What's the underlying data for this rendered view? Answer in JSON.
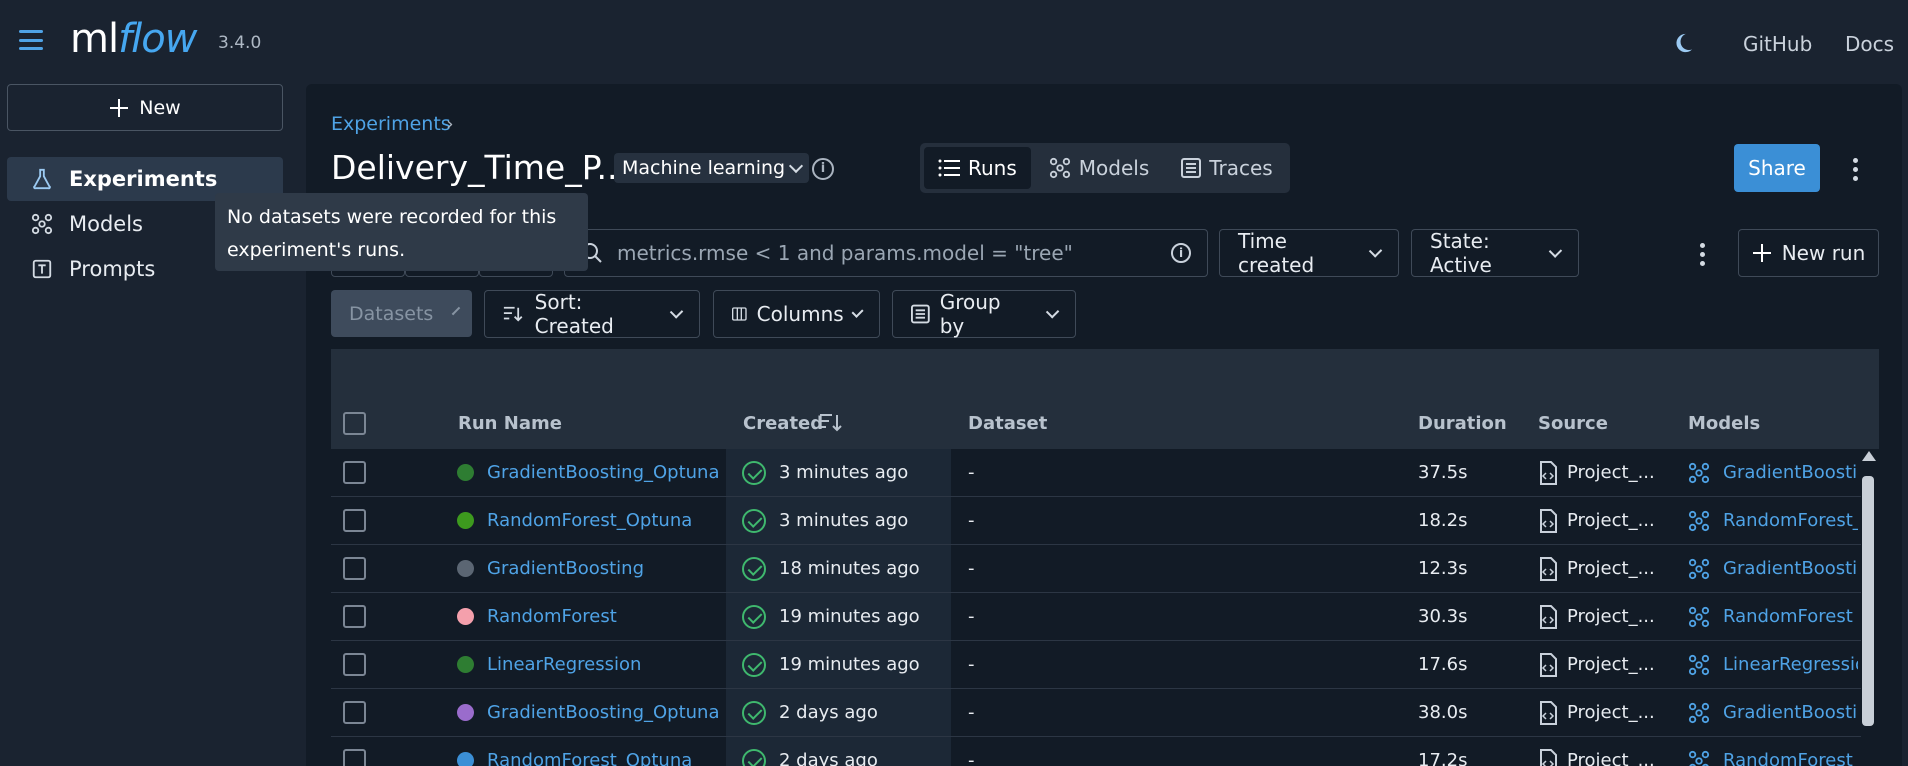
{
  "app": {
    "logo_ml": "ml",
    "logo_flow": "flow",
    "version": "3.4.0",
    "github_label": "GitHub",
    "docs_label": "Docs"
  },
  "sidebar": {
    "new_label": "New",
    "items": [
      {
        "label": "Experiments",
        "icon": "flask-icon"
      },
      {
        "label": "Models",
        "icon": "models-icon"
      },
      {
        "label": "Prompts",
        "icon": "prompt-icon"
      }
    ]
  },
  "header": {
    "breadcrumb": "Experiments",
    "title": "Delivery_Time_P...",
    "type_label": "Machine learning",
    "tabs": [
      {
        "label": "Runs"
      },
      {
        "label": "Models"
      },
      {
        "label": "Traces"
      }
    ],
    "share_label": "Share"
  },
  "tooltip": {
    "text_line1": "No datasets were recorded for this",
    "text_line2": "experiment's runs."
  },
  "toolbar": {
    "search_placeholder": "metrics.rmse < 1 and params.model = \"tree\"",
    "time_created": "Time created",
    "state": "State: Active",
    "new_run": "New run",
    "datasets": "Datasets",
    "sort": "Sort: Created",
    "columns": "Columns",
    "group_by": "Group by"
  },
  "table": {
    "headers": [
      "Run Name",
      "Created",
      "Dataset",
      "Duration",
      "Source",
      "Models"
    ],
    "rows": [
      {
        "name": "GradientBoosting_Optuna",
        "color": "#2e7d32",
        "created": "3 minutes ago",
        "dataset": "-",
        "duration": "37.5s",
        "source": "Project_...",
        "model": "GradientBoosting"
      },
      {
        "name": "RandomForest_Optuna",
        "color": "#3d9a1e",
        "created": "3 minutes ago",
        "dataset": "-",
        "duration": "18.2s",
        "source": "Project_...",
        "model": "RandomForest_O"
      },
      {
        "name": "GradientBoosting",
        "color": "#5b6673",
        "created": "18 minutes ago",
        "dataset": "-",
        "duration": "12.3s",
        "source": "Project_...",
        "model": "GradientBoosting"
      },
      {
        "name": "RandomForest",
        "color": "#f4a0ac",
        "created": "19 minutes ago",
        "dataset": "-",
        "duration": "30.3s",
        "source": "Project_...",
        "model": "RandomForest"
      },
      {
        "name": "LinearRegression",
        "color": "#2e7d32",
        "created": "19 minutes ago",
        "dataset": "-",
        "duration": "17.6s",
        "source": "Project_...",
        "model": "LinearRegression"
      },
      {
        "name": "GradientBoosting_Optuna",
        "color": "#9a6ccc",
        "created": "2 days ago",
        "dataset": "-",
        "duration": "38.0s",
        "source": "Project_...",
        "model": "GradientBoosting"
      },
      {
        "name": "RandomForest_Optuna",
        "color": "#3b8fd6",
        "created": "2 days ago",
        "dataset": "-",
        "duration": "17.2s",
        "source": "Project_...",
        "model": "RandomForest_O"
      }
    ]
  }
}
